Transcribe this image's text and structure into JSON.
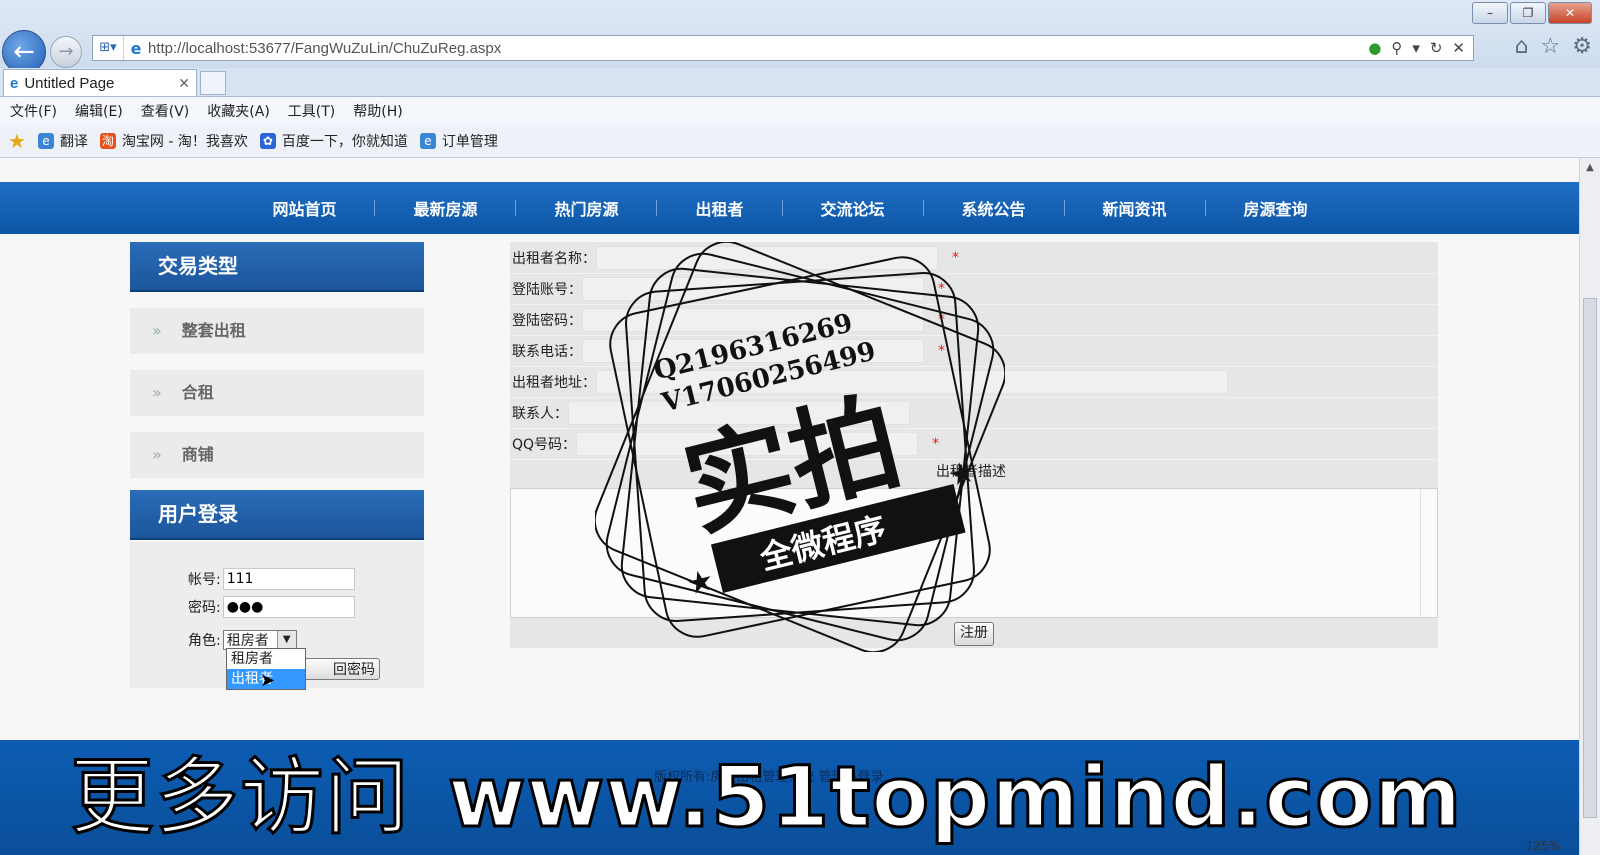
{
  "browser": {
    "address_url": "http://localhost:53677/FangWuZuLin/ChuZuReg.aspx",
    "tab_title": "Untitled Page",
    "menu": [
      "文件(F)",
      "编辑(E)",
      "查看(V)",
      "收藏夹(A)",
      "工具(T)",
      "帮助(H)"
    ],
    "favorites": [
      "翻译",
      "淘宝网 - 淘！我喜欢",
      "百度一下，你就知道",
      "订单管理"
    ],
    "zoom_level": "125%"
  },
  "nav": {
    "items": [
      "网站首页",
      "最新房源",
      "热门房源",
      "出租者",
      "交流论坛",
      "系统公告",
      "新闻资讯",
      "房源查询"
    ]
  },
  "sidebar": {
    "trade_title": "交易类型",
    "trade_items": [
      "整套出租",
      "合租",
      "商铺"
    ],
    "login_title": "用户登录",
    "account_label": "帐号:",
    "account_value": "111",
    "password_label": "密码:",
    "password_value": "●●●",
    "role_label": "角色:",
    "role_selected": "租房者",
    "role_options": [
      "租房者",
      "出租者"
    ],
    "role_highlighted": "出租者",
    "retrieve_label": "回密码"
  },
  "form": {
    "fields": [
      {
        "label": "出租者名称：",
        "required": true
      },
      {
        "label": "登陆账号：",
        "required": true
      },
      {
        "label": "登陆密码：",
        "required": true
      },
      {
        "label": "联系电话：",
        "required": true
      },
      {
        "label": "出租者地址：",
        "required": false
      },
      {
        "label": "联系人：",
        "required": false
      },
      {
        "label": "QQ号码：",
        "required": true
      }
    ],
    "required_mark": "*",
    "description_label": "出租者描述",
    "submit_label": "注册"
  },
  "footer": {
    "copyright": "版权所有:房屋出租管理系统  管理员登录"
  },
  "watermark": {
    "stamp_lines": [
      "Q2196316269",
      "V17060256499"
    ],
    "stamp_main": "实拍",
    "stamp_banner": "全微程序",
    "promo_cn": "更多访问",
    "promo_url": "www.51topmind.com"
  }
}
